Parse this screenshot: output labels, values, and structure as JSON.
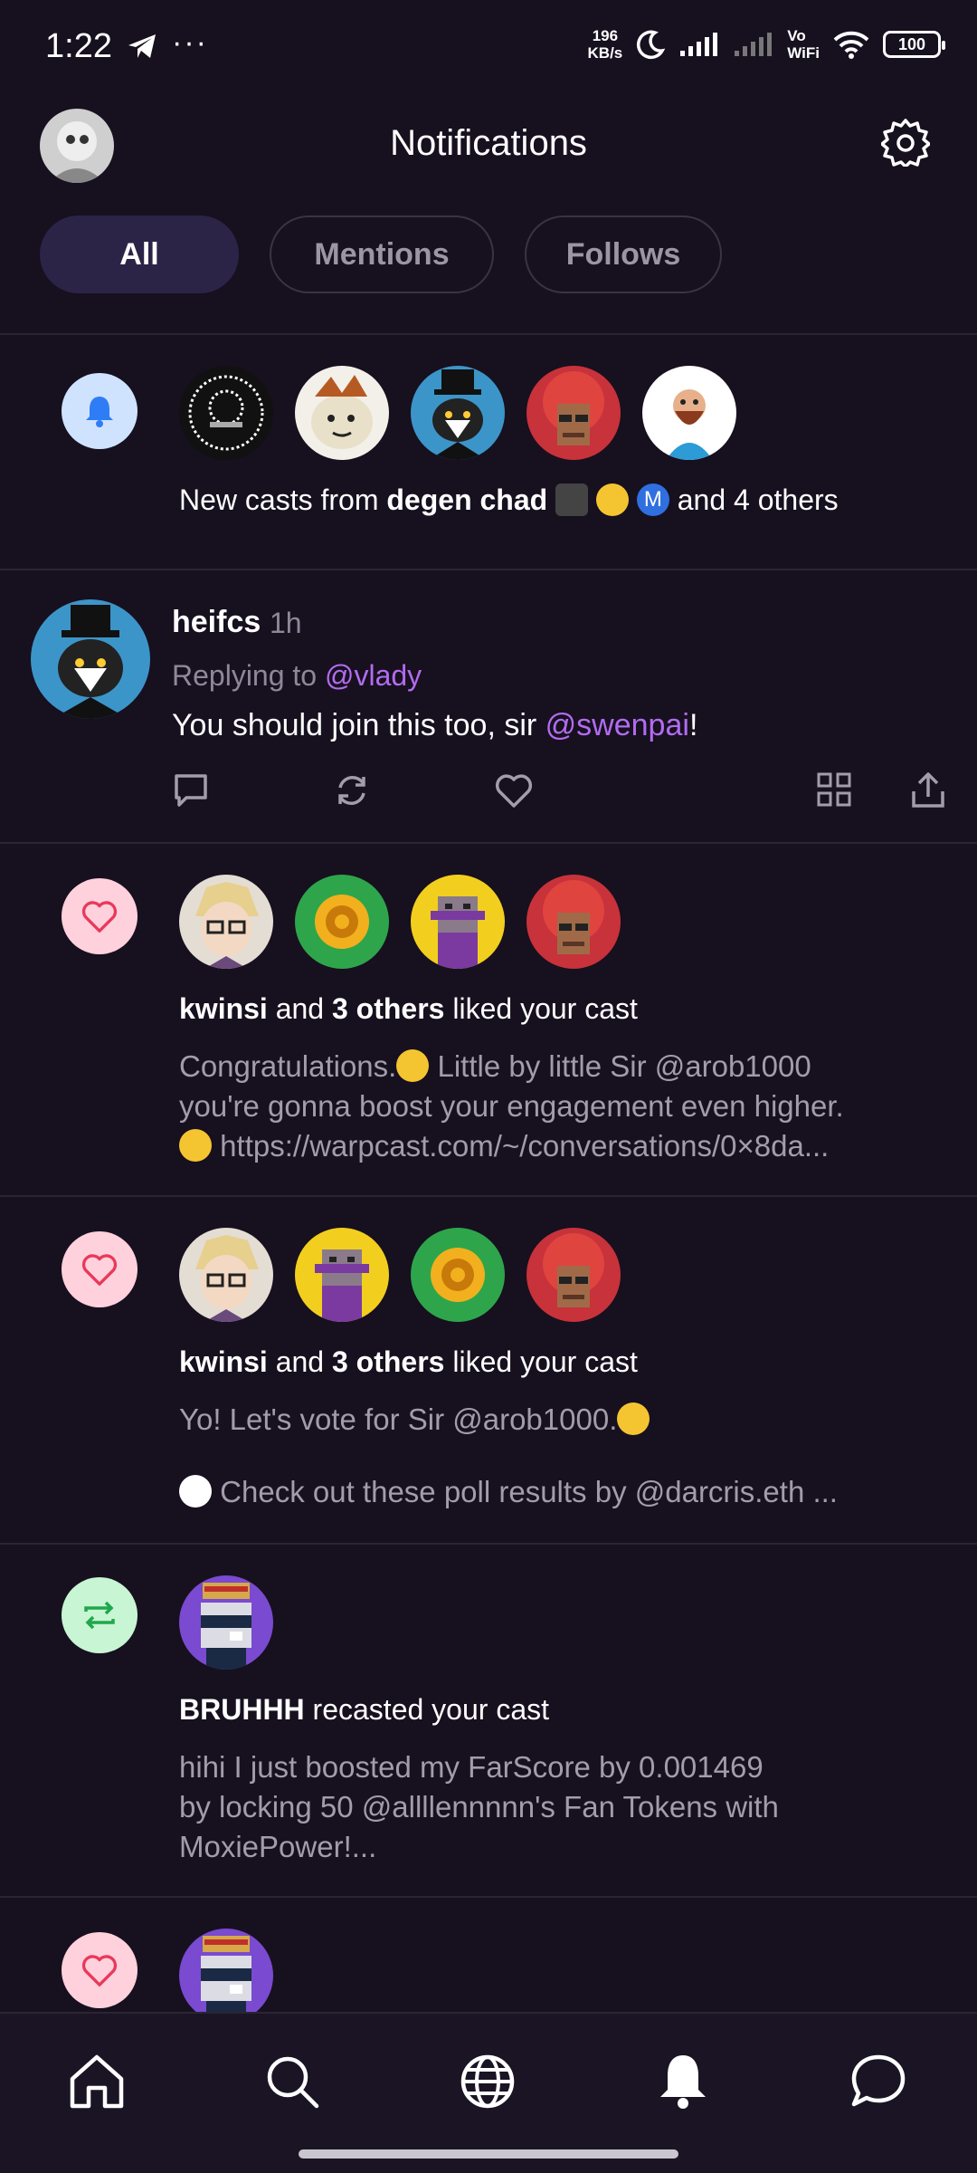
{
  "status_bar": {
    "time": "1:22",
    "speed_value": "196",
    "speed_unit": "KB/s",
    "vo": "Vo",
    "wifi_label": "WiFi",
    "battery": "100"
  },
  "header": {
    "title": "Notifications"
  },
  "tabs": [
    {
      "label": "All",
      "active": true
    },
    {
      "label": "Mentions",
      "active": false
    },
    {
      "label": "Follows",
      "active": false
    }
  ],
  "notifications": {
    "new_casts": {
      "prefix": "New casts from ",
      "name": "degen chad",
      "suffix": " and 4 others"
    },
    "cast": {
      "username": "heifcs",
      "time": "1h",
      "replying_prefix": "Replying to ",
      "replying_to": "@vlady",
      "text_prefix": "You should join this too, sir ",
      "text_mention": "@swenpai",
      "text_suffix": "!"
    },
    "like1": {
      "name": "kwinsi",
      "and": " and ",
      "others": "3 others",
      "action": " liked your cast",
      "preview_line1": "Congratulations.",
      "preview_line1b": " Little by little Sir @arob1000",
      "preview_line2": "you're gonna boost your engagement even higher.",
      "preview_line3": " https://warpcast.com/~/conversations/0×8da..."
    },
    "like2": {
      "name": "kwinsi",
      "and": " and ",
      "others": "3 others",
      "action": " liked your cast",
      "preview_line1": "Yo! Let's vote for Sir @arob1000.",
      "preview_line2": " Check out these poll results by @darcris.eth ..."
    },
    "recast": {
      "name": "BRUHHH",
      "action": " recasted your cast",
      "preview_line1": "hihi I just boosted my FarScore by 0.001469",
      "preview_line2": "by locking 50 @allllennnnn's Fan Tokens with",
      "preview_line3": "MoxiePower!..."
    }
  },
  "bottom_nav": [
    "home-icon",
    "search-icon",
    "globe-icon",
    "bell-icon",
    "chat-icon"
  ],
  "colors": {
    "background": "#17101f",
    "mention": "#b26cf0",
    "active_tab": "#2c2447"
  }
}
